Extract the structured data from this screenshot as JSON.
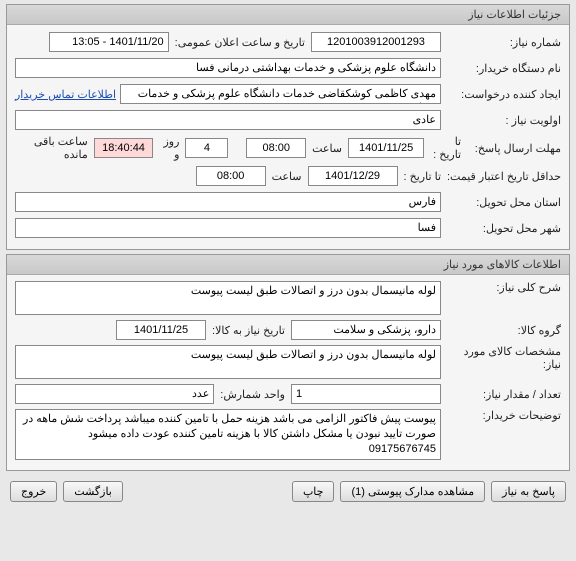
{
  "panel1": {
    "title": "جزئیات اطلاعات نیاز",
    "need_no_label": "شماره نیاز:",
    "need_no": "1201003912001293",
    "announce_label": "تاریخ و ساعت اعلان عمومی:",
    "announce_val": "1401/11/20 - 13:05",
    "buyer_label": "نام دستگاه خریدار:",
    "buyer_val": "دانشگاه علوم پزشکی و خدمات بهداشتی درمانی فسا",
    "requester_label": "ایجاد کننده درخواست:",
    "requester_val": "مهدی  کاظمی کوشکقاضی خدمات دانشگاه علوم پزشکی و خدمات بهداشتی د",
    "contact_link": "اطلاعات تماس خریدار",
    "priority_label": "اولویت نیاز :",
    "priority_val": "عادی",
    "deadline_label": "مهلت ارسال پاسخ:",
    "to_date_label": "تا تاریخ :",
    "deadline_date": "1401/11/25",
    "time_label": "ساعت",
    "deadline_time": "08:00",
    "remain_days": "4",
    "days_and_label": "روز و",
    "remain_time": "18:40:44",
    "remain_suffix": "ساعت باقی مانده",
    "price_validity_label": "حداقل تاریخ اعتبار قیمت:",
    "price_validity_date": "1401/12/29",
    "price_validity_time": "08:00",
    "province_label": "استان محل تحویل:",
    "province_val": "فارس",
    "city_label": "شهر محل تحویل:",
    "city_val": "فسا"
  },
  "panel2": {
    "title": "اطلاعات کالاهای مورد نیاز",
    "desc_label": "شرح کلی نیاز:",
    "desc_val": "لوله مانیسمال بدون درز و اتصالات طبق لیست پیوست",
    "group_label": "گروه کالا:",
    "group_val": "دارو، پزشکی و سلامت",
    "need_date_label": "تاریخ نیاز به کالا:",
    "need_date_val": "1401/11/25",
    "spec_label": "مشخصات کالای مورد نیاز:",
    "spec_val": "لوله مانیسمال بدون درز و اتصالات طبق لیست پیوست",
    "qty_label": "تعداد / مقدار نیاز:",
    "qty_val": "1",
    "unit_label": "واحد شمارش:",
    "unit_val": "عدد",
    "buyer_notes_label": "توضیحات خریدار:",
    "buyer_notes_val": "پیوست پیش فاکتور الزامی می باشد هزینه حمل با تامین کننده میباشد پرداخت شش ماهه در صورت تایید نبودن یا مشکل داشتن کالا با هزینه تامین کننده عودت داده میشود 09175676745"
  },
  "buttons": {
    "respond": "پاسخ به نیاز",
    "attachments": "مشاهده مدارک پیوستی (1)",
    "print": "چاپ",
    "back": "بازگشت",
    "exit": "خروج"
  }
}
